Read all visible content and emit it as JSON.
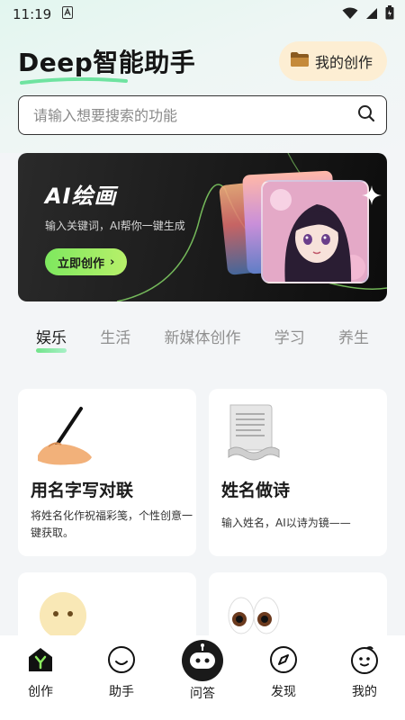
{
  "status_bar": {
    "time": "11:19"
  },
  "header": {
    "title": "Deep智能助手",
    "my_creations": "我的创作"
  },
  "search": {
    "placeholder": "请输入想要搜索的功能"
  },
  "banner": {
    "title": "AI绘画",
    "subtitle": "输入关键词，AI帮你一键生成",
    "button": "立即创作"
  },
  "tabs": [
    {
      "label": "娱乐",
      "active": true
    },
    {
      "label": "生活",
      "active": false
    },
    {
      "label": "新媒体创作",
      "active": false
    },
    {
      "label": "学习",
      "active": false
    },
    {
      "label": "养生",
      "active": false
    }
  ],
  "cards": [
    {
      "title": "用名字写对联",
      "desc": "将姓名化作祝福彩笺，个性创意一键获取。",
      "icon": "writing-hand-icon"
    },
    {
      "title": "姓名做诗",
      "desc": "输入姓名，AI以诗为镜——",
      "icon": "paper-scroll-icon"
    },
    {
      "title": "",
      "desc": "",
      "icon": "sparkle-face-icon"
    },
    {
      "title": "",
      "desc": "",
      "icon": "eyes-icon"
    }
  ],
  "tabbar": [
    {
      "label": "创作",
      "icon": "create-icon"
    },
    {
      "label": "助手",
      "icon": "smile-icon"
    },
    {
      "label": "问答",
      "icon": "robot-icon"
    },
    {
      "label": "发现",
      "icon": "compass-icon"
    },
    {
      "label": "我的",
      "icon": "profile-icon"
    }
  ],
  "colors": {
    "accent_green": "#7ee85f",
    "badge_bg": "#fdeed3",
    "banner_bg": "#1a1a1a"
  }
}
